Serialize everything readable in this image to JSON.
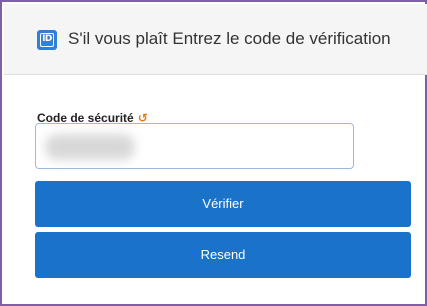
{
  "header": {
    "icon": "id-card-icon",
    "icon_text": "ID",
    "title": "S'il vous plaît Entrez le code de vérification"
  },
  "form": {
    "code_label": "Code de sécurité",
    "refresh_icon": "refresh-icon",
    "code_value": "",
    "verify_label": "Vérifier",
    "resend_label": "Resend"
  },
  "colors": {
    "accent": "#1a73c8",
    "border": "#7e5fa8",
    "refresh": "#e07a10",
    "header_bg": "#f5f5f5"
  }
}
